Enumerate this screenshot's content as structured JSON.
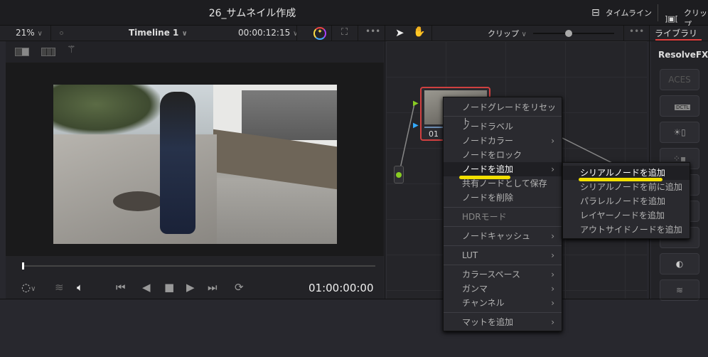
{
  "titlebar": {
    "project_title": "26_サムネイル作成",
    "timeline_button": "タイムライン",
    "clip_button": "クリップ"
  },
  "viewer": {
    "zoom": "21%",
    "timeline_name": "Timeline 1",
    "source_timecode": "00:00:12:15",
    "playhead_timecode": "01:00:00:00",
    "scrub_position": 0.0
  },
  "nodes": {
    "mode": "クリップ",
    "node_label": "01"
  },
  "library": {
    "tab": "ライブラリ",
    "section": "ResolveFX カ",
    "dctl_label": "DCTL",
    "aces_label": "ACES"
  },
  "context_menu": {
    "items": [
      "ノードグレードをリセット",
      "ノードラベル",
      "ノードカラー",
      "ノードをロック",
      "ノードを追加",
      "共有ノードとして保存",
      "ノードを削除",
      "HDRモード",
      "ノードキャッシュ",
      "LUT",
      "カラースペース",
      "ガンマ",
      "チャンネル",
      "マットを追加"
    ]
  },
  "submenu": {
    "items": [
      "シリアルノードを追加",
      "シリアルノードを前に追加",
      "パラレルノードを追加",
      "レイヤーノードを追加",
      "アウトサイドノードを追加"
    ]
  },
  "colors": {
    "highlight": "#f2e000",
    "node_border": "#d04040",
    "tab_underline": "#e04040"
  }
}
